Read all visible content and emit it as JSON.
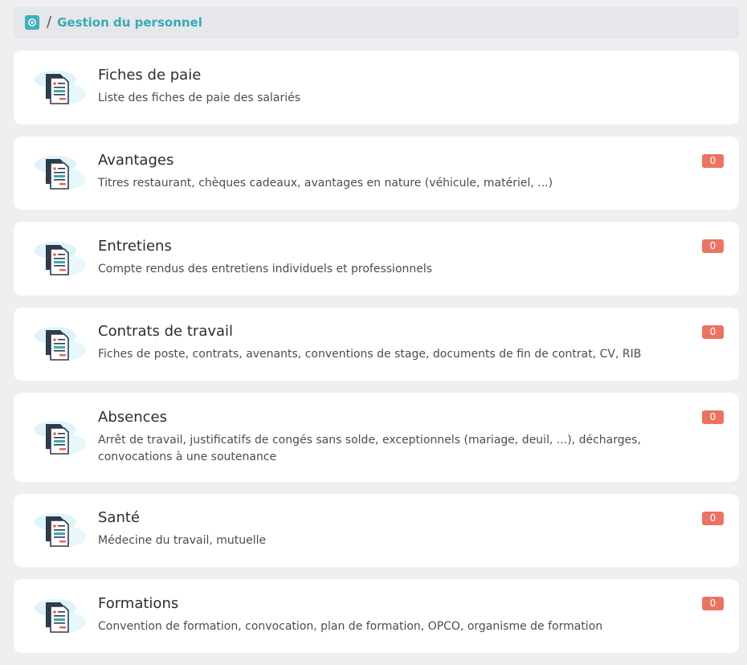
{
  "breadcrumb": {
    "home_icon": "home-icon",
    "separator": "/",
    "current": "Gestion du personnel"
  },
  "colors": {
    "accent": "#3aa9b7",
    "badge": "#ea7462",
    "card_bg": "#ffffff",
    "page_bg": "#eeeff1"
  },
  "cards": [
    {
      "title": "Fiches de paie",
      "description": "Liste des fiches de paie des salariés",
      "badge": null,
      "icon": "document-icon"
    },
    {
      "title": "Avantages",
      "description": "Titres restaurant, chèques cadeaux, avantages en nature (véhicule, matériel, ...)",
      "badge": "0",
      "icon": "document-icon"
    },
    {
      "title": "Entretiens",
      "description": "Compte rendus des entretiens individuels et professionnels",
      "badge": "0",
      "icon": "document-icon"
    },
    {
      "title": "Contrats de travail",
      "description": "Fiches de poste, contrats, avenants, conventions de stage, documents de fin de contrat, CV, RIB",
      "badge": "0",
      "icon": "document-icon"
    },
    {
      "title": "Absences",
      "description": "Arrêt de travail, justificatifs de congés sans solde, exceptionnels (mariage, deuil, ...), décharges, convocations à une soutenance",
      "badge": "0",
      "icon": "document-icon"
    },
    {
      "title": "Santé",
      "description": "Médecine du travail, mutuelle",
      "badge": "0",
      "icon": "document-icon"
    },
    {
      "title": "Formations",
      "description": "Convention de formation, convocation, plan de formation, OPCO, organisme de formation",
      "badge": "0",
      "icon": "document-icon"
    }
  ]
}
